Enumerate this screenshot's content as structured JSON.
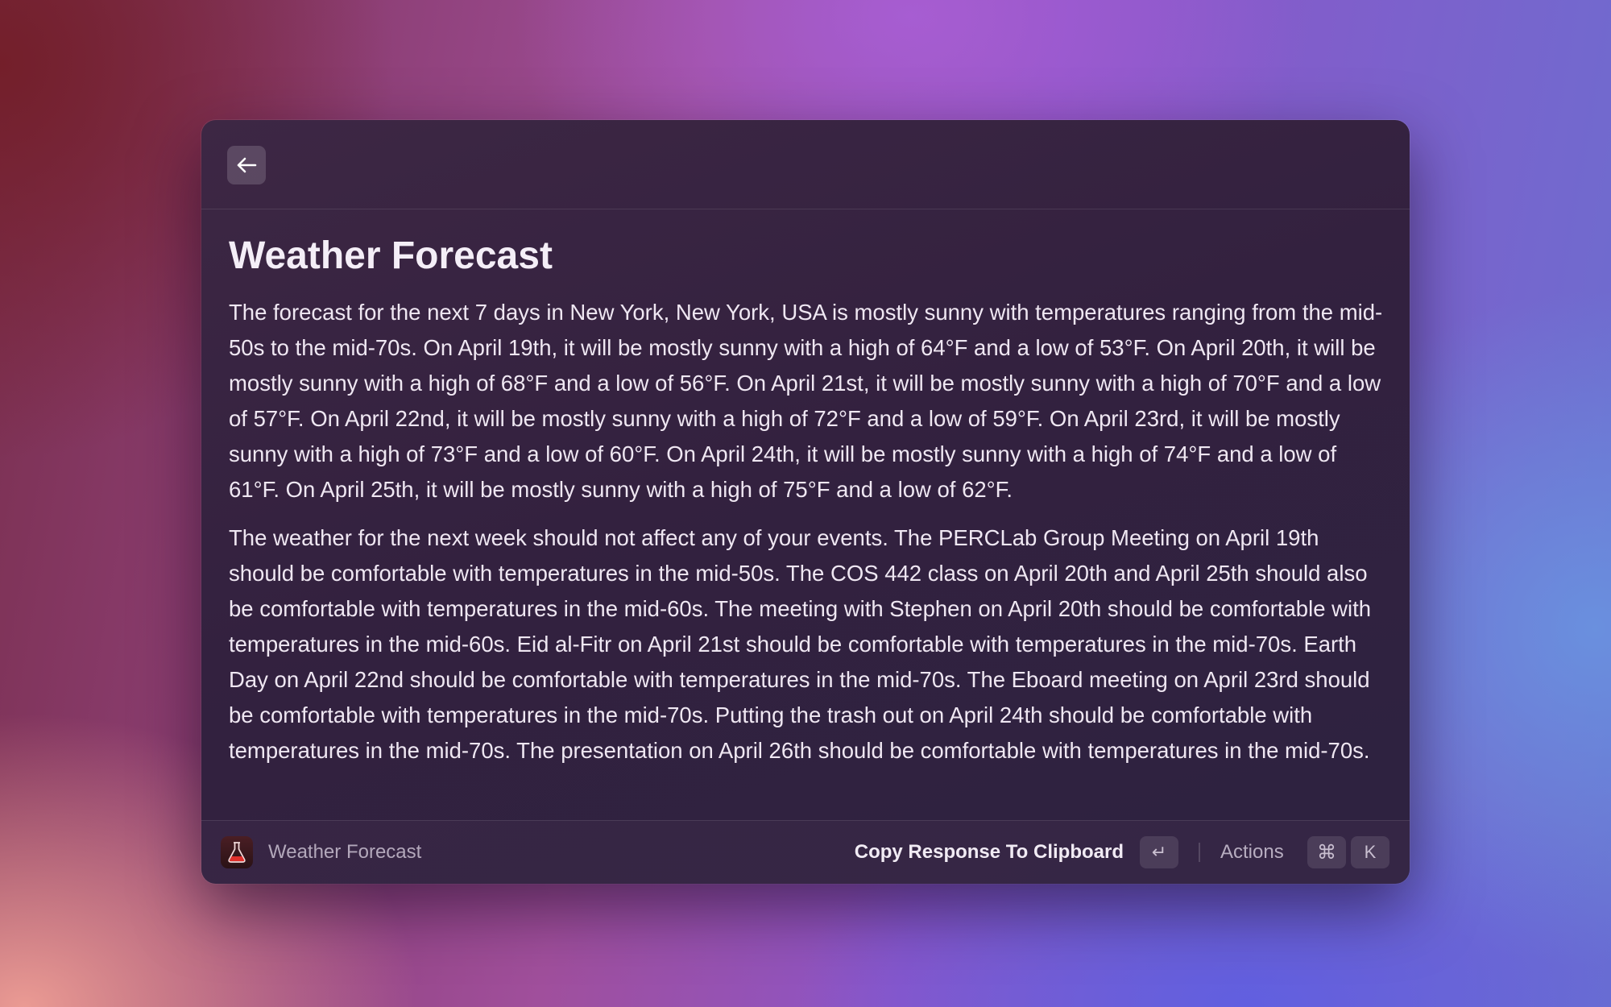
{
  "window": {
    "back_icon": "arrow-left-icon"
  },
  "content": {
    "title": "Weather Forecast",
    "paragraphs": [
      "The forecast for the next 7 days in New York, New York, USA is mostly sunny with temperatures ranging from the mid-50s to the mid-70s. On April 19th, it will be mostly sunny with a high of 64°F and a low of 53°F. On April 20th, it will be mostly sunny with a high of 68°F and a low of 56°F. On April 21st, it will be mostly sunny with a high of 70°F and a low of 57°F. On April 22nd, it will be mostly sunny with a high of 72°F and a low of 59°F. On April 23rd, it will be mostly sunny with a high of 73°F and a low of 60°F. On April 24th, it will be mostly sunny with a high of 74°F and a low of 61°F. On April 25th, it will be mostly sunny with a high of 75°F and a low of 62°F.",
      "The weather for the next week should not affect any of your events. The PERCLab Group Meeting on April 19th should be comfortable with temperatures in the mid-50s. The COS 442 class on April 20th and April 25th should also be comfortable with temperatures in the mid-60s. The meeting with Stephen on April 20th should be comfortable with temperatures in the mid-60s. Eid al-Fitr on April 21st should be comfortable with temperatures in the mid-70s. Earth Day on April 22nd should be comfortable with temperatures in the mid-70s. The Eboard meeting on April 23rd should be comfortable with temperatures in the mid-70s. Putting the trash out on April 24th should be comfortable with temperatures in the mid-70s. The presentation on April 26th should be comfortable with temperatures in the mid-70s."
    ]
  },
  "bottom_bar": {
    "app_icon": "flask-icon",
    "app_name": "Weather Forecast",
    "primary_action": "Copy Response To Clipboard",
    "primary_shortcut": "↵",
    "actions_label": "Actions",
    "actions_shortcut": [
      "⌘",
      "K"
    ]
  },
  "colors": {
    "window_bg": "#33213f",
    "text": "#efe7f2",
    "muted_text": "#b3a8bb",
    "app_icon_accent": "#e0302c"
  }
}
